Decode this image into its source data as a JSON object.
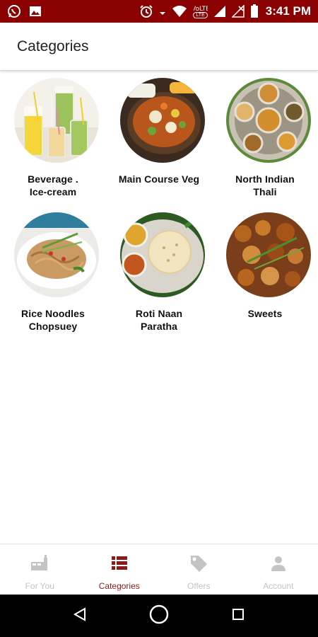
{
  "status_bar": {
    "time": "3:41 PM",
    "left_icons": [
      "whatsapp-icon",
      "gallery-icon"
    ],
    "right_icons": [
      "alarm-icon",
      "data-arrows-icon",
      "wifi-icon",
      "volte-icon",
      "signal-icon",
      "no-signal-icon",
      "battery-icon"
    ],
    "volte_text": "LTE"
  },
  "header": {
    "title": "Categories"
  },
  "categories": [
    {
      "label": "Beverage .\nIce-cream",
      "icon": "beverage-image"
    },
    {
      "label": "Main Course Veg",
      "icon": "main-course-image"
    },
    {
      "label": "North Indian\nThali",
      "icon": "thali-image"
    },
    {
      "label": "Rice Noodles\nChopsuey",
      "icon": "noodles-image"
    },
    {
      "label": "Roti Naan\nParatha",
      "icon": "roti-image"
    },
    {
      "label": "Sweets",
      "icon": "sweets-image"
    }
  ],
  "bottom_nav": {
    "items": [
      {
        "label": "For You",
        "icon": "food-tray-icon",
        "active": false
      },
      {
        "label": "Categories",
        "icon": "list-icon",
        "active": true
      },
      {
        "label": "Offers",
        "icon": "tag-icon",
        "active": false
      },
      {
        "label": "Account",
        "icon": "person-icon",
        "active": false
      }
    ],
    "active_color": "#8b1a1a",
    "inactive_color": "#c4c4c4"
  },
  "system_nav": {
    "buttons": [
      "back-icon",
      "home-icon",
      "recents-icon"
    ]
  },
  "colors": {
    "status_bar": "#8b0000",
    "accent": "#8b1a1a"
  }
}
